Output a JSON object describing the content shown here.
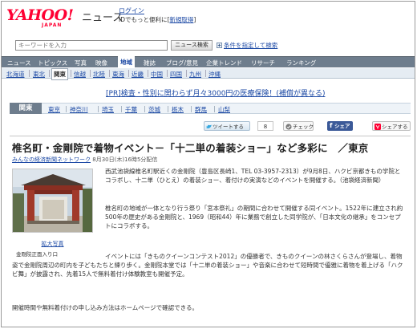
{
  "header": {
    "logo": "YAHOO!",
    "logo_sub": "JAPAN",
    "site_name": "ニュース",
    "login_label": "ログイン",
    "login_sub_text": "IDでもっと便利に[",
    "register_label": "新規取得",
    "login_sub_end": "]"
  },
  "search": {
    "placeholder": "キーワードを入力",
    "button_label": "ニュース検索",
    "conditions_label": "条件を指定して検索"
  },
  "nav_primary": [
    "ニュース",
    "トピックス",
    "写真",
    "映像",
    "地域",
    "雑誌",
    "ブログ/意見",
    "企業トレンド",
    "リサーチ",
    "ランキング"
  ],
  "nav_primary_active": "地域",
  "nav_regions": [
    "北海道",
    "東北",
    "関東",
    "信越",
    "北陸",
    "東海",
    "近畿",
    "中国",
    "四国",
    "九州",
    "沖縄"
  ],
  "nav_regions_active": "関東",
  "pr": {
    "tag": "[PR]",
    "text": "検査・性別に関わらず月々3000円の医療保険！(補償が異なる)"
  },
  "region_bar": {
    "label": "関東",
    "prefectures": [
      "東京",
      "神奈川",
      "埼玉",
      "千葉",
      "茨城",
      "栃木",
      "群馬",
      "山梨"
    ]
  },
  "social": {
    "tweet_label": "ツイートする",
    "tweet_count": "8",
    "check_label": "チェック",
    "fb_label": "シェア",
    "share_label": "シェアする"
  },
  "article": {
    "title": "椎名町・金剛院で着物イベント－「十二単の着装ショー」など多彩に　／東京",
    "source_link": "みんなの経済新聞ネットワーク",
    "timestamp": "8月30日(木)16時5分配信",
    "photo_link": "拡大写真",
    "photo_caption": "金剛院正面入り口",
    "paragraphs": [
      "西武池袋線椎名町駅近くの金剛院（豊島区長崎1、TEL 03-3957-2313）が9月8日、ハクビ京都きもの学院とコラボし、十二単（ひとえ）の着装ショー、着付けの実演などのイベントを開催する。（池袋経済新聞）",
      "椎名町の地域が一体となり行う祭り「宮本祭礼」の期間に合わせて開催する同イベント。1522年に建立され約500年の歴史がある金剛院と、1969（昭和44）年に業務で創立した同学院が、「日本文化の継承」をコンセプトにコラボする。",
      "イベントには「きものクイーンコンテスト2012」の優勝者で、きものクイーンの林さくらさんが登場し、着物姿で金剛院周辺の町内を子どもたちと練り歩く。金剛院本堂では「十二単の着装ショー」や音楽に合わせて短時間で優雅に着物を着上げる「ハクビ舞」が披露され、先着15人で無料着付け体験教室も開催予定。",
      "開催時間や無料着付けの申し込み方法はホームページで確認できる。"
    ]
  },
  "colors": {
    "brand_red": "#ff0033",
    "link_blue": "#1d4aa5",
    "nav_gray": "#6e7d8d",
    "facebook_blue": "#3b5998"
  }
}
